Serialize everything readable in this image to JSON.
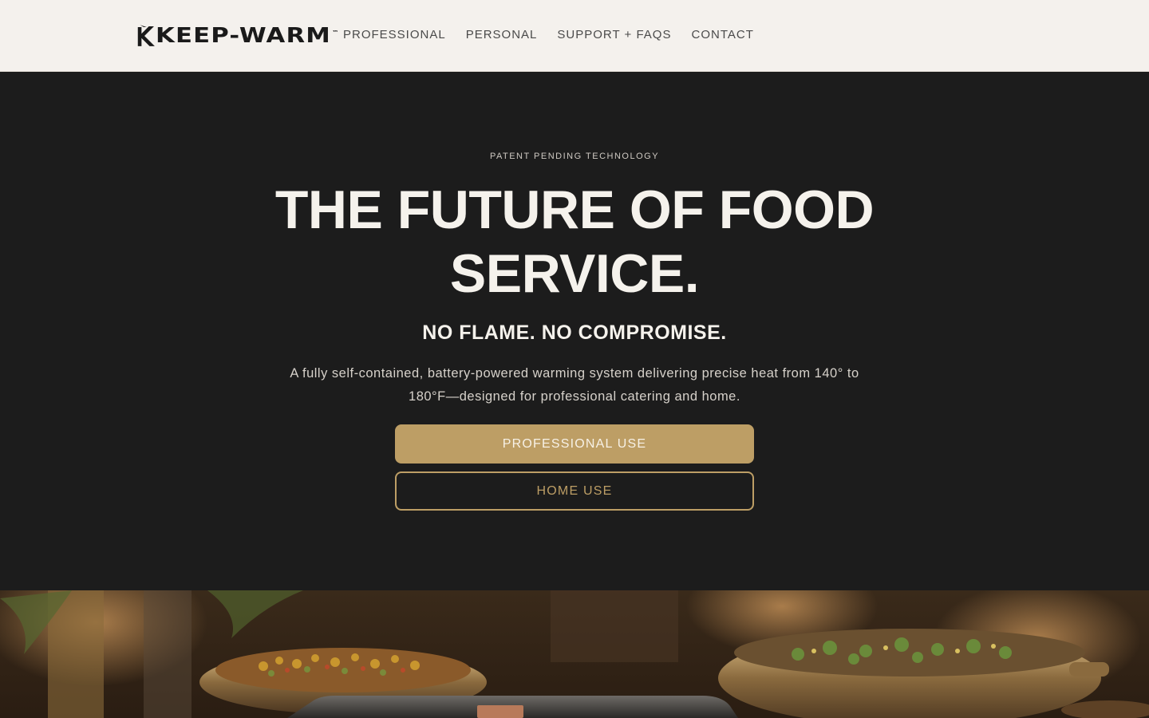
{
  "header": {
    "logo_text": "KEEP-WARM",
    "logo_tm": "™",
    "nav": [
      {
        "label": "PROFESSIONAL"
      },
      {
        "label": "PERSONAL"
      },
      {
        "label": "SUPPORT + FAQS"
      },
      {
        "label": "CONTACT"
      }
    ]
  },
  "hero": {
    "eyebrow": "PATENT PENDING TECHNOLOGY",
    "headline": "THE FUTURE OF FOOD SERVICE.",
    "subhead": "NO FLAME. NO COMPROMISE.",
    "description": "A fully self-contained, battery-powered warming system delivering precise heat from 140° to 180°F—designed for professional catering and home.",
    "primary_button": "PROFESSIONAL USE",
    "secondary_button": "HOME USE"
  },
  "colors": {
    "header_bg": "#f4f1ed",
    "hero_bg": "#1c1c1c",
    "accent_gold": "#bd9e65",
    "headline_text": "#f5f2ec"
  }
}
